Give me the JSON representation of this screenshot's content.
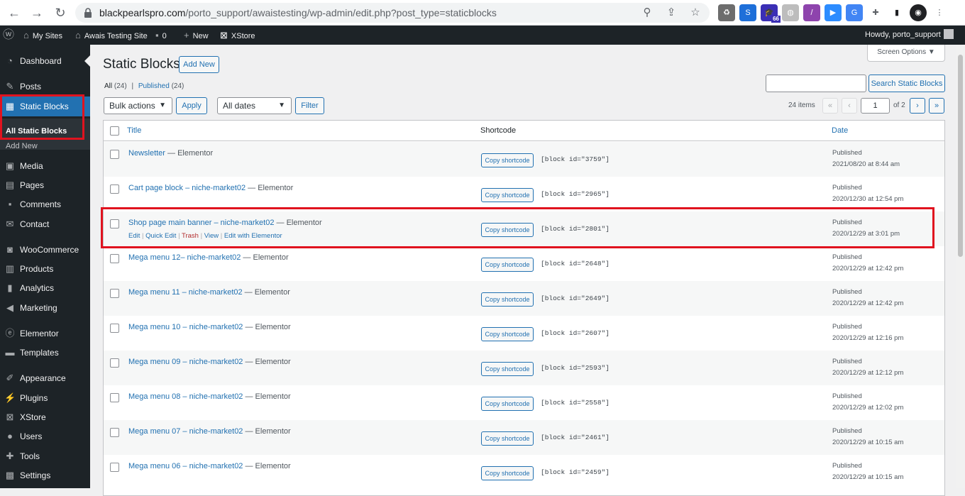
{
  "browser": {
    "url_host": "blackpearlspro.com",
    "url_path": "/porto_support/awaistesting/wp-admin/edit.php?post_type=staticblocks",
    "extension_badge": "66"
  },
  "adminbar": {
    "my_sites": "My Sites",
    "site_name": "Awais Testing Site",
    "comments_count": "0",
    "new_label": "New",
    "xstore_label": "XStore",
    "howdy": "Howdy, porto_support"
  },
  "sidebar": {
    "items": [
      {
        "label": "Dashboard",
        "icon": "dashboard-icon"
      },
      {
        "label": "Posts",
        "icon": "pin-icon"
      },
      {
        "label": "Static Blocks",
        "icon": "table-icon"
      },
      {
        "label": "Media",
        "icon": "media-icon"
      },
      {
        "label": "Pages",
        "icon": "pages-icon"
      },
      {
        "label": "Comments",
        "icon": "comment-icon"
      },
      {
        "label": "Contact",
        "icon": "mail-icon"
      },
      {
        "label": "WooCommerce",
        "icon": "woo-icon"
      },
      {
        "label": "Products",
        "icon": "archive-icon"
      },
      {
        "label": "Analytics",
        "icon": "chart-icon"
      },
      {
        "label": "Marketing",
        "icon": "megaphone-icon"
      },
      {
        "label": "Elementor",
        "icon": "elementor-icon"
      },
      {
        "label": "Templates",
        "icon": "folder-icon"
      },
      {
        "label": "Appearance",
        "icon": "brush-icon"
      },
      {
        "label": "Plugins",
        "icon": "plugin-icon"
      },
      {
        "label": "XStore",
        "icon": "xstore-icon"
      },
      {
        "label": "Users",
        "icon": "user-icon"
      },
      {
        "label": "Tools",
        "icon": "wrench-icon"
      },
      {
        "label": "Settings",
        "icon": "settings-icon"
      }
    ],
    "submenu": {
      "all": "All Static Blocks",
      "add_new": "Add New"
    }
  },
  "page": {
    "title": "Static Blocks",
    "add_new": "Add New",
    "screen_options": "Screen Options ▼",
    "filter_all": "All",
    "filter_all_count": "(24)",
    "filter_sep": "|",
    "filter_published": "Published",
    "filter_published_count": "(24)",
    "search_button": "Search Static Blocks",
    "bulk_actions": "Bulk actions",
    "apply": "Apply",
    "all_dates": "All dates",
    "filter": "Filter",
    "items_count": "24 items",
    "first": "«",
    "prev": "‹",
    "current_page": "1",
    "of_pages": "of 2",
    "next": "›",
    "last": "»"
  },
  "table": {
    "headers": {
      "title": "Title",
      "shortcode": "Shortcode",
      "date": "Date"
    },
    "copy_label": "Copy shortcode",
    "row_actions": {
      "edit": "Edit",
      "quick_edit": "Quick Edit",
      "trash": "Trash",
      "view": "View",
      "edit_elementor": "Edit with Elementor",
      "sep": "|"
    },
    "rows": [
      {
        "title": "Newsletter",
        "suffix": " — Elementor",
        "code": "[block id=\"3759\"]",
        "status": "Published",
        "date": "2021/08/20 at 8:44 am"
      },
      {
        "title": "Cart page block – niche-market02",
        "suffix": " — Elementor",
        "code": "[block id=\"2965\"]",
        "status": "Published",
        "date": "2020/12/30 at 12:54 pm"
      },
      {
        "title": "Shop page main banner – niche-market02",
        "suffix": " — Elementor",
        "code": "[block id=\"2801\"]",
        "status": "Published",
        "date": "2020/12/29 at 3:01 pm"
      },
      {
        "title": "Mega menu 12– niche-market02",
        "suffix": " — Elementor",
        "code": "[block id=\"2648\"]",
        "status": "Published",
        "date": "2020/12/29 at 12:42 pm"
      },
      {
        "title": "Mega menu 11 – niche-market02",
        "suffix": " — Elementor",
        "code": "[block id=\"2649\"]",
        "status": "Published",
        "date": "2020/12/29 at 12:42 pm"
      },
      {
        "title": "Mega menu 10 – niche-market02",
        "suffix": " — Elementor",
        "code": "[block id=\"2607\"]",
        "status": "Published",
        "date": "2020/12/29 at 12:16 pm"
      },
      {
        "title": "Mega menu 09 – niche-market02",
        "suffix": " — Elementor",
        "code": "[block id=\"2593\"]",
        "status": "Published",
        "date": "2020/12/29 at 12:12 pm"
      },
      {
        "title": "Mega menu 08 – niche-market02",
        "suffix": " — Elementor",
        "code": "[block id=\"2558\"]",
        "status": "Published",
        "date": "2020/12/29 at 12:02 pm"
      },
      {
        "title": "Mega menu 07 – niche-market02",
        "suffix": " — Elementor",
        "code": "[block id=\"2461\"]",
        "status": "Published",
        "date": "2020/12/29 at 10:15 am"
      },
      {
        "title": "Mega menu 06 – niche-market02",
        "suffix": " — Elementor",
        "code": "[block id=\"2459\"]",
        "status": "Published",
        "date": "2020/12/29 at 10:15 am"
      }
    ]
  },
  "colors": {
    "accent": "#2271b1",
    "admin_dark": "#1d2327",
    "highlight": "#e0131f"
  }
}
